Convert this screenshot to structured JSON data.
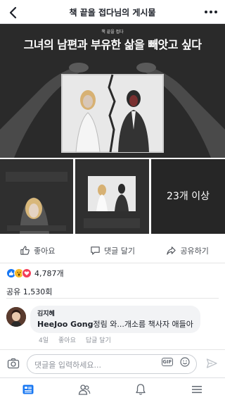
{
  "header": {
    "title": "책 끝을 접다님의 게시물",
    "back_icon": "chevron-left-icon",
    "more_icon": "more-dots-icon"
  },
  "post": {
    "hero": {
      "tagline": "책 끝을 접다",
      "headline": "그녀의 남편과 부유한 삶을 빼앗고 싶다"
    },
    "thumbnails": [
      {
        "caption": ""
      },
      {
        "caption": ""
      },
      {
        "caption": "23개 이상"
      }
    ],
    "actions": {
      "like": "좋아요",
      "comment": "댓글 달기",
      "share": "공유하기"
    },
    "reactions": {
      "types": [
        "like",
        "wow",
        "love"
      ],
      "count": "4,787개"
    },
    "shares": "공유 1,530회"
  },
  "comments": [
    {
      "author": "김지혜",
      "mention": "HeeJoo Gong",
      "text": "정림 와...개소름 책사자 애들아",
      "time": "4일",
      "like_label": "좋아요",
      "reply_label": "답글 달기"
    }
  ],
  "composer": {
    "placeholder": "댓글을 입력하세요...",
    "gif_label": "GIF"
  },
  "tabs": [
    "news-feed",
    "friends",
    "notifications",
    "menu"
  ],
  "colors": {
    "accent": "#1877f2",
    "text": "#1d2129",
    "muted": "#90949c"
  }
}
